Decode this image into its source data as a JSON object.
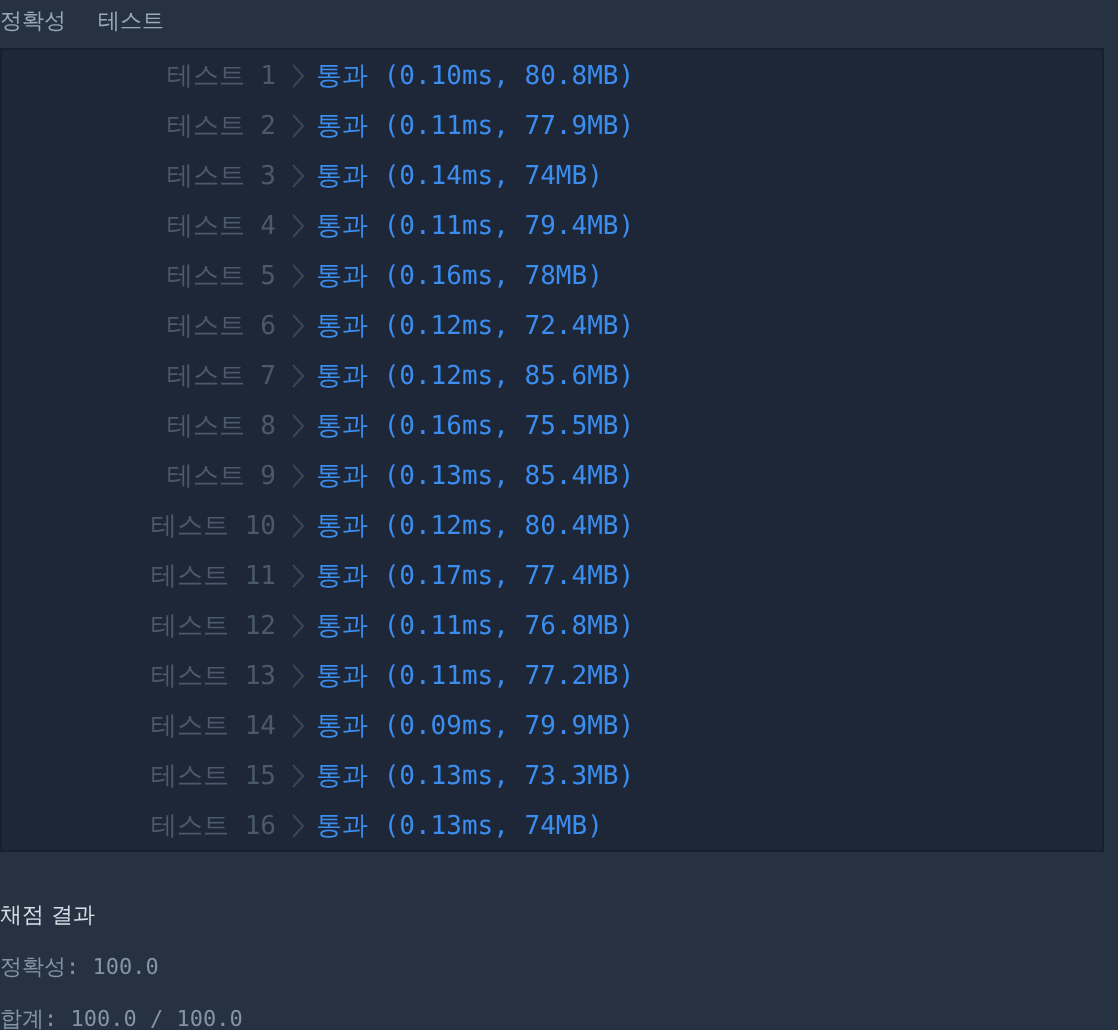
{
  "header": {
    "title": "정확성",
    "subtitle": "테스트"
  },
  "tests": [
    {
      "label": "테스트 1",
      "result": "통과 (0.10ms, 80.8MB)"
    },
    {
      "label": "테스트 2",
      "result": "통과 (0.11ms, 77.9MB)"
    },
    {
      "label": "테스트 3",
      "result": "통과 (0.14ms, 74MB)"
    },
    {
      "label": "테스트 4",
      "result": "통과 (0.11ms, 79.4MB)"
    },
    {
      "label": "테스트 5",
      "result": "통과 (0.16ms, 78MB)"
    },
    {
      "label": "테스트 6",
      "result": "통과 (0.12ms, 72.4MB)"
    },
    {
      "label": "테스트 7",
      "result": "통과 (0.12ms, 85.6MB)"
    },
    {
      "label": "테스트 8",
      "result": "통과 (0.16ms, 75.5MB)"
    },
    {
      "label": "테스트 9",
      "result": "통과 (0.13ms, 85.4MB)"
    },
    {
      "label": "테스트 10",
      "result": "통과 (0.12ms, 80.4MB)"
    },
    {
      "label": "테스트 11",
      "result": "통과 (0.17ms, 77.4MB)"
    },
    {
      "label": "테스트 12",
      "result": "통과 (0.11ms, 76.8MB)"
    },
    {
      "label": "테스트 13",
      "result": "통과 (0.11ms, 77.2MB)"
    },
    {
      "label": "테스트 14",
      "result": "통과 (0.09ms, 79.9MB)"
    },
    {
      "label": "테스트 15",
      "result": "통과 (0.13ms, 73.3MB)"
    },
    {
      "label": "테스트 16",
      "result": "통과 (0.13ms, 74MB)"
    }
  ],
  "summary": {
    "title": "채점 결과",
    "lines": [
      "정확성: 100.0",
      "합계: 100.0 / 100.0"
    ]
  }
}
